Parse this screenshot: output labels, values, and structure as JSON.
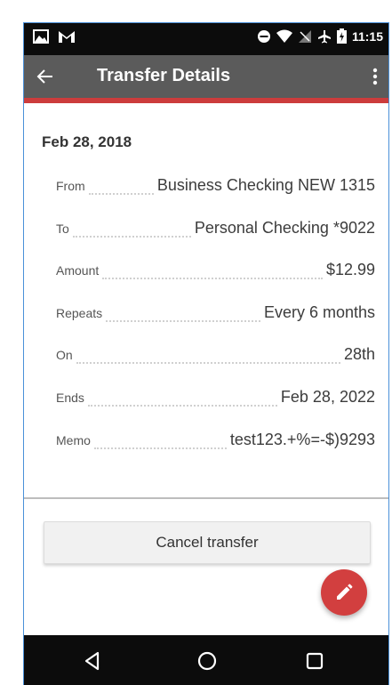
{
  "status_bar": {
    "time": "11:15",
    "left_icons": [
      "image-notification-icon",
      "gmail-icon"
    ],
    "right_icons": [
      "do-not-disturb-icon",
      "wifi-icon",
      "no-signal-icon",
      "airplane-mode-icon",
      "battery-icon"
    ]
  },
  "app_bar": {
    "title": "Transfer Details",
    "back_icon": "arrow-back-icon",
    "menu_icon": "more-vertical-icon",
    "accent_color": "#cc3c3c"
  },
  "transfer": {
    "date": "Feb 28, 2018",
    "rows": [
      {
        "label": "From",
        "value": "Business Checking NEW 1315"
      },
      {
        "label": "To",
        "value": "Personal Checking *9022"
      },
      {
        "label": "Amount",
        "value": "$12.99"
      },
      {
        "label": "Repeats",
        "value": "Every 6 months"
      },
      {
        "label": "On",
        "value": "28th"
      },
      {
        "label": "Ends",
        "value": "Feb 28, 2022"
      },
      {
        "label": "Memo",
        "value": "test123.+%=-$)9293"
      }
    ]
  },
  "actions": {
    "cancel_label": "Cancel transfer",
    "fab_icon": "edit-pencil-icon",
    "fab_color": "#d23f3f"
  },
  "nav_bar": {
    "icons": [
      "back-triangle-icon",
      "home-circle-icon",
      "recents-square-icon"
    ]
  }
}
